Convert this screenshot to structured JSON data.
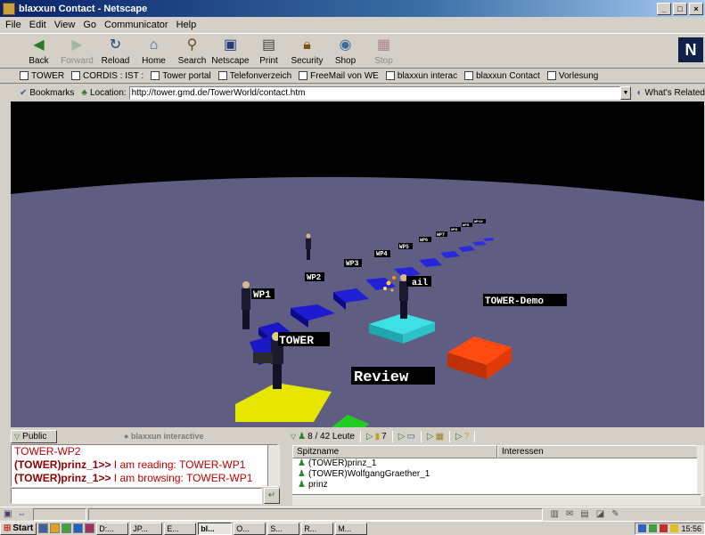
{
  "window": {
    "title": "blaxxun Contact - Netscape",
    "controls": [
      "_",
      "□",
      "×"
    ]
  },
  "menu": [
    "File",
    "Edit",
    "View",
    "Go",
    "Communicator",
    "Help"
  ],
  "toolbar": [
    {
      "label": "Back",
      "icon": "back-arrow-icon",
      "enabled": true
    },
    {
      "label": "Forward",
      "icon": "forward-arrow-icon",
      "enabled": false
    },
    {
      "label": "Reload",
      "icon": "reload-icon",
      "enabled": true
    },
    {
      "label": "Home",
      "icon": "home-icon",
      "enabled": true
    },
    {
      "label": "Search",
      "icon": "search-icon",
      "enabled": true
    },
    {
      "label": "Netscape",
      "icon": "netscape-icon",
      "enabled": true
    },
    {
      "label": "Print",
      "icon": "print-icon",
      "enabled": true
    },
    {
      "label": "Security",
      "icon": "lock-icon",
      "enabled": true
    },
    {
      "label": "Shop",
      "icon": "shop-icon",
      "enabled": true
    },
    {
      "label": "Stop",
      "icon": "stop-icon",
      "enabled": false
    }
  ],
  "personal_toolbar": [
    "TOWER",
    "CORDIS : IST :",
    "Tower portal",
    "Telefonverzeich",
    "FreeMail von WE",
    "blaxxun interac",
    "blaxxun Contact",
    "Vorlesung"
  ],
  "location": {
    "bookmarks_label": "Bookmarks",
    "location_label": "Location:",
    "url": "http://tower.gmd.de/TowerWorld/contact.htm",
    "related_label": "What's Related"
  },
  "scene": {
    "labels": {
      "wp1": "WP1",
      "wp2": "WP2",
      "wp3": "WP3",
      "wp4": "WP4",
      "wp5": "WP5",
      "wp6": "WP6",
      "wp7": "WP7",
      "wp8": "WP8",
      "wp9": "WP9",
      "wp10": "WP10",
      "tower": "TOWER",
      "review": "Review",
      "mail": "ail",
      "tower_demo": "TOWER-Demo"
    },
    "colors": {
      "sky": "#000000",
      "floor": "#5f5d82",
      "path": "#1a18c4",
      "yellow_pad": "#e6e600",
      "cyan_pad": "#3fdfe6",
      "orange_pad": "#ff4a10",
      "green_pad": "#22cc22"
    }
  },
  "chat": {
    "tab_label": "Public",
    "brand": "blaxxun interactive",
    "lines": [
      {
        "nick": "",
        "text": "TOWER-WP2"
      },
      {
        "nick": "(TOWER)prinz_1>>",
        "text": " I am reading: TOWER-WP1"
      },
      {
        "nick": "(TOWER)prinz_1>>",
        "text": " I am browsing: TOWER-WP1"
      }
    ],
    "input_value": ""
  },
  "people": {
    "count_label": "8 / 42 Leute",
    "page_value": "7",
    "columns": [
      "Spitzname",
      "Interessen"
    ],
    "rows": [
      "(TOWER)prinz_1",
      "(TOWER)WolfgangGraether_1",
      "prinz"
    ]
  },
  "taskbar": {
    "start_label": "Start",
    "tasks": [
      "D:...",
      "JP...",
      "E...",
      "bl...",
      "O...",
      "S...",
      "R...",
      "M..."
    ],
    "clock": "15:56"
  }
}
